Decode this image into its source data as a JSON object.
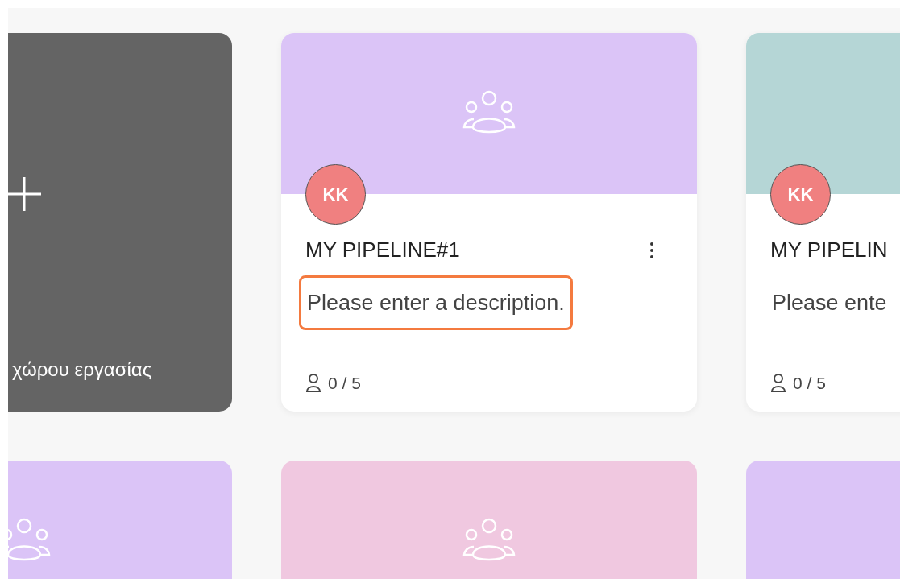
{
  "create_card": {
    "label": "χώρου εργασίας"
  },
  "pipelines": [
    {
      "title": "MY PIPELINE#1",
      "description": "Please enter a description.",
      "members": "0 / 5",
      "avatar": "KK",
      "color": "#dbc4f7",
      "editing": true
    },
    {
      "title": "MY PIPELIN",
      "description": "Please ente",
      "members": "0 / 5",
      "avatar": "KK",
      "color": "#b5d6d6",
      "editing": false
    }
  ],
  "more_cards": [
    {
      "color": "#dbc4f7"
    },
    {
      "color": "#f0c8e0"
    },
    {
      "color": "#dbc4f7"
    }
  ]
}
